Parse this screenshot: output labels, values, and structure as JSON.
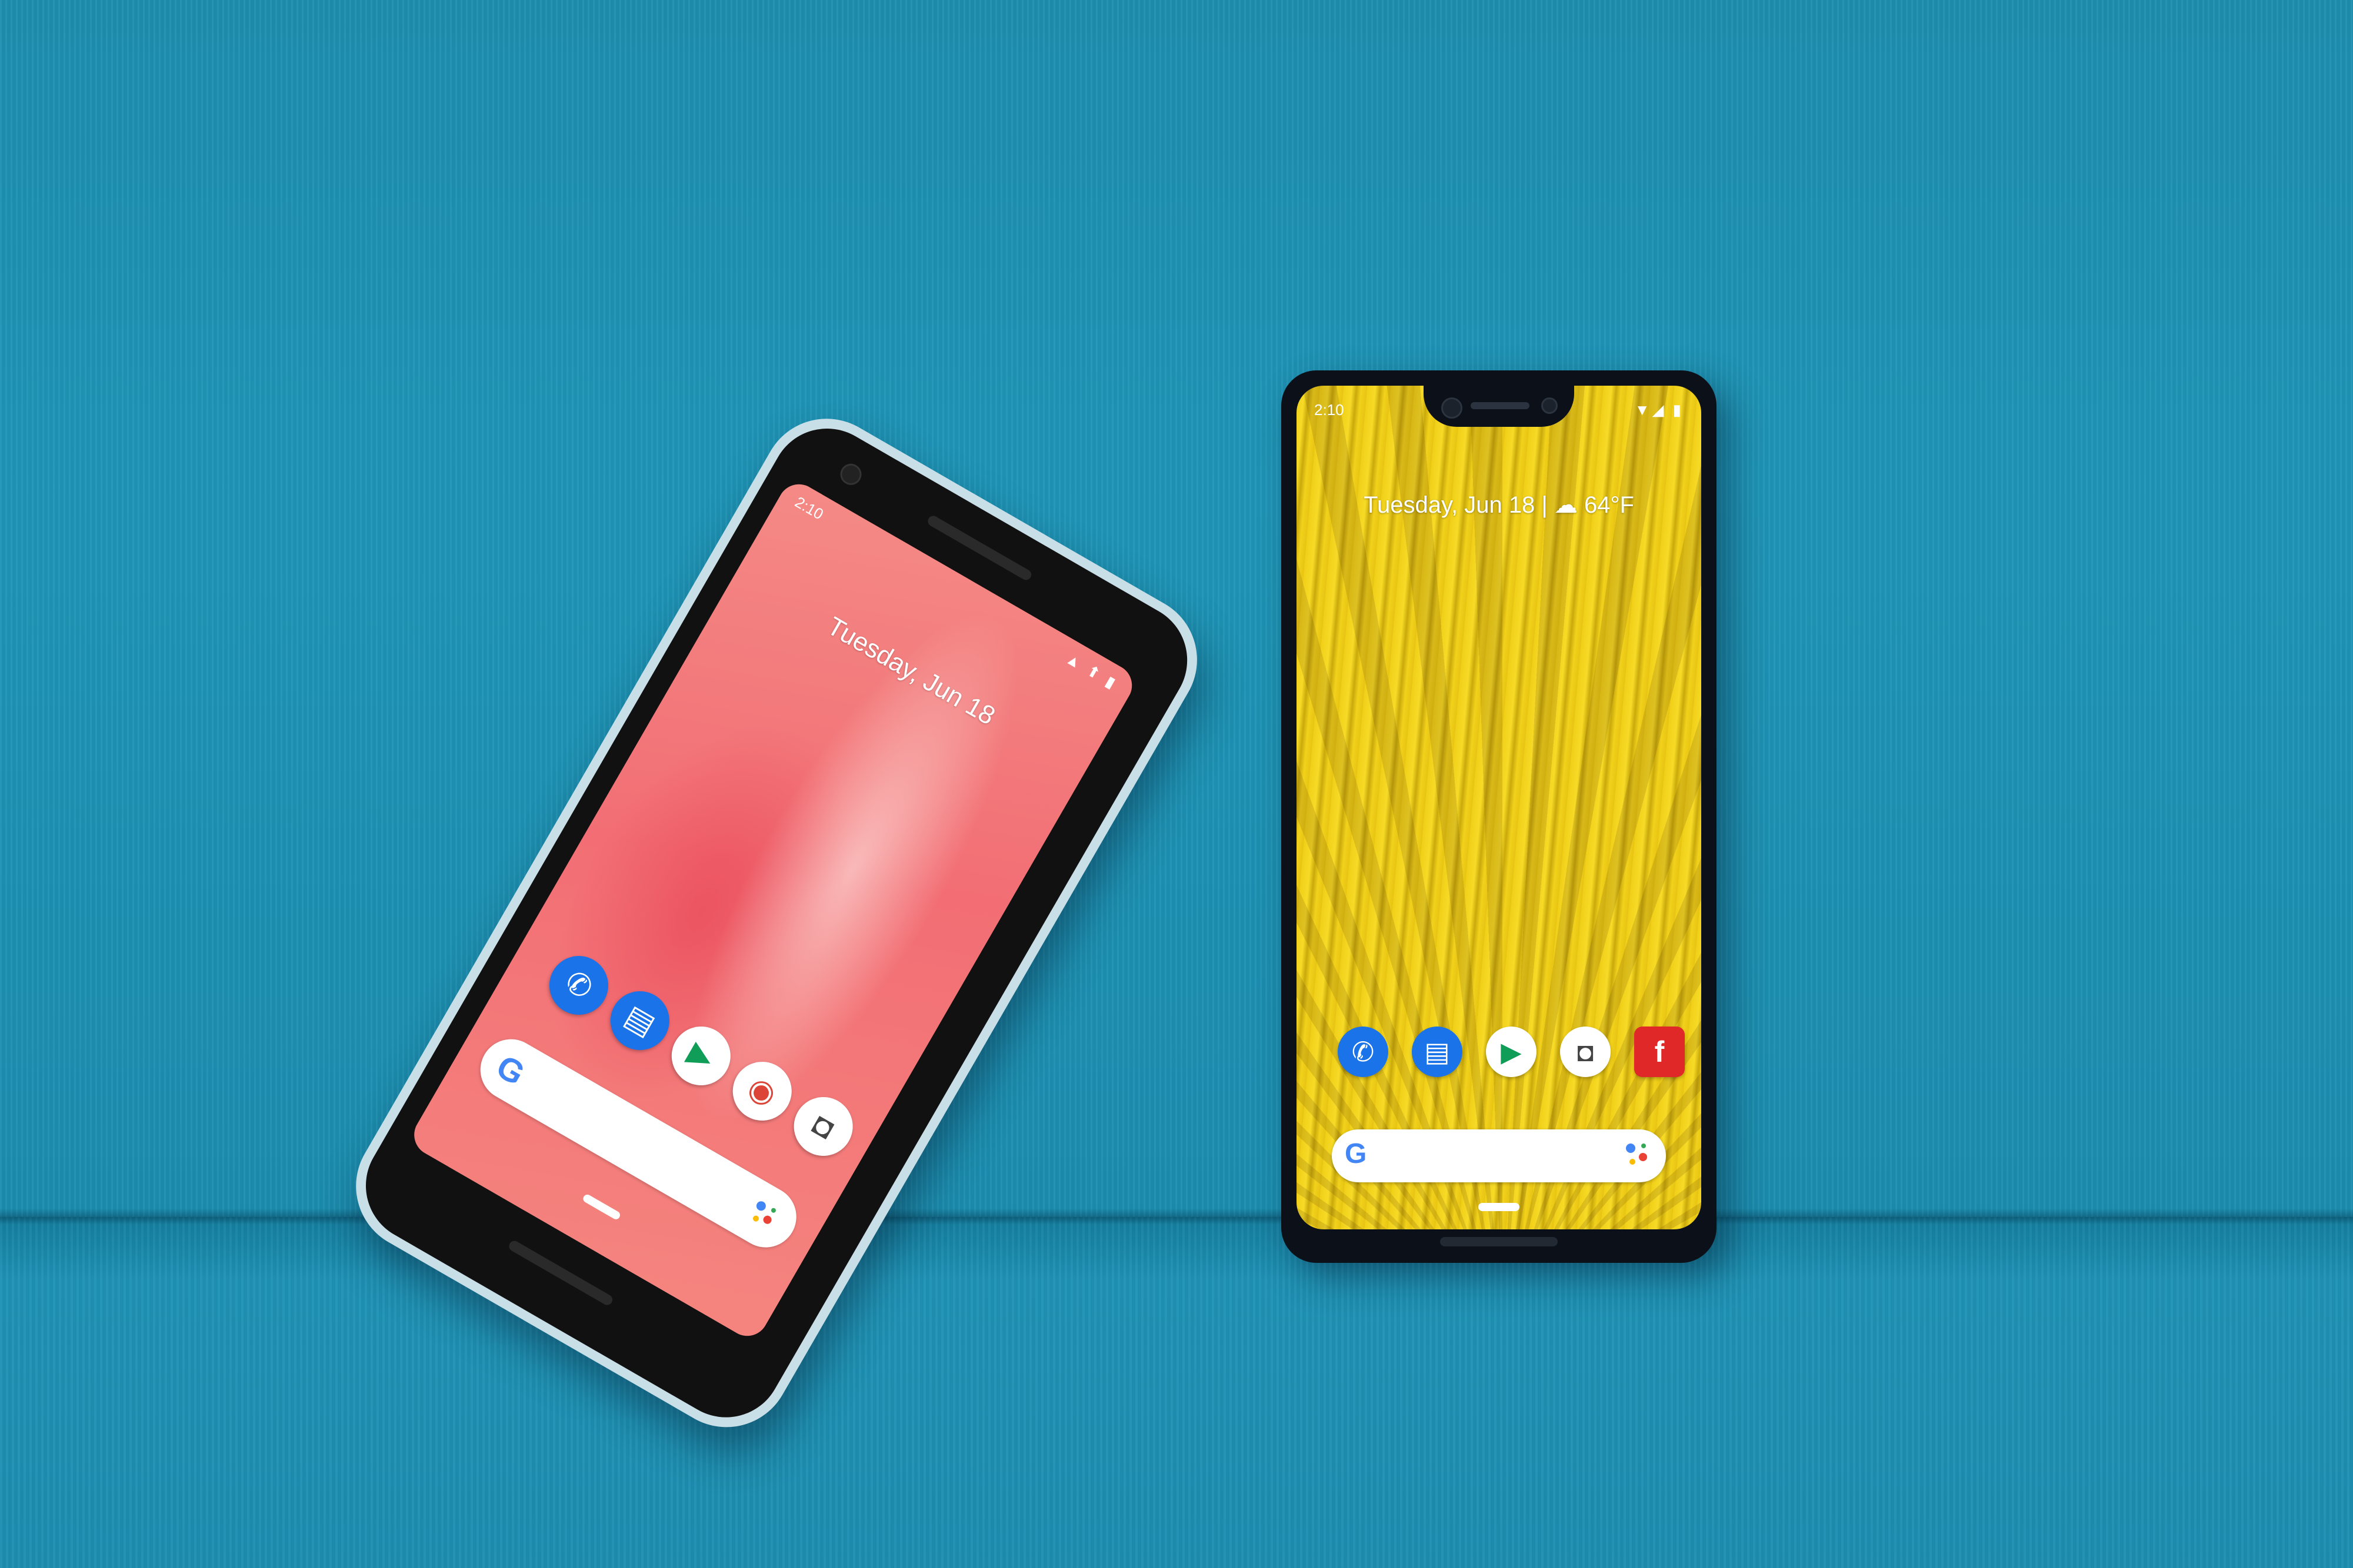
{
  "photo": {
    "background_color": "#1f93b6",
    "phone_left": {
      "status": {
        "time": "2:10",
        "icons": "▲ ⬆ ▮"
      },
      "date": "Tuesday, Jun 18",
      "dock_apps": [
        {
          "name": "Phone",
          "icon": "phone-icon",
          "color": "#1a73e8",
          "glyph": "✆"
        },
        {
          "name": "Messages",
          "icon": "messages-icon",
          "color": "#1a73e8",
          "glyph": "▤"
        },
        {
          "name": "Play Store",
          "icon": "play-store-icon",
          "color": "#ffffff",
          "glyph": "▶"
        },
        {
          "name": "Chrome",
          "icon": "chrome-icon",
          "color": "#ffffff",
          "glyph": "◉"
        },
        {
          "name": "Camera",
          "icon": "camera-icon",
          "color": "#ffffff",
          "glyph": "◘"
        }
      ],
      "search_logo": "G",
      "wallpaper_color": "#f4807f"
    },
    "phone_right": {
      "status": {
        "time": "2:10",
        "icons": "▼◢ ▮"
      },
      "date": "Tuesday, Jun 18 | ☁ 64°F",
      "dock_apps": [
        {
          "name": "Phone",
          "icon": "phone-icon",
          "color": "#1a73e8",
          "glyph": "✆"
        },
        {
          "name": "Messages",
          "icon": "messages-icon",
          "color": "#1a73e8",
          "glyph": "▤"
        },
        {
          "name": "Play Store",
          "icon": "play-store-icon",
          "color": "#ffffff",
          "glyph": "▶"
        },
        {
          "name": "Camera",
          "icon": "camera-icon",
          "color": "#ffffff",
          "glyph": "◘"
        },
        {
          "name": "Flipboard",
          "icon": "flipboard-icon",
          "color": "#e12828",
          "glyph": "f"
        }
      ],
      "search_logo": "G",
      "wallpaper_color": "#f0d21a"
    }
  }
}
